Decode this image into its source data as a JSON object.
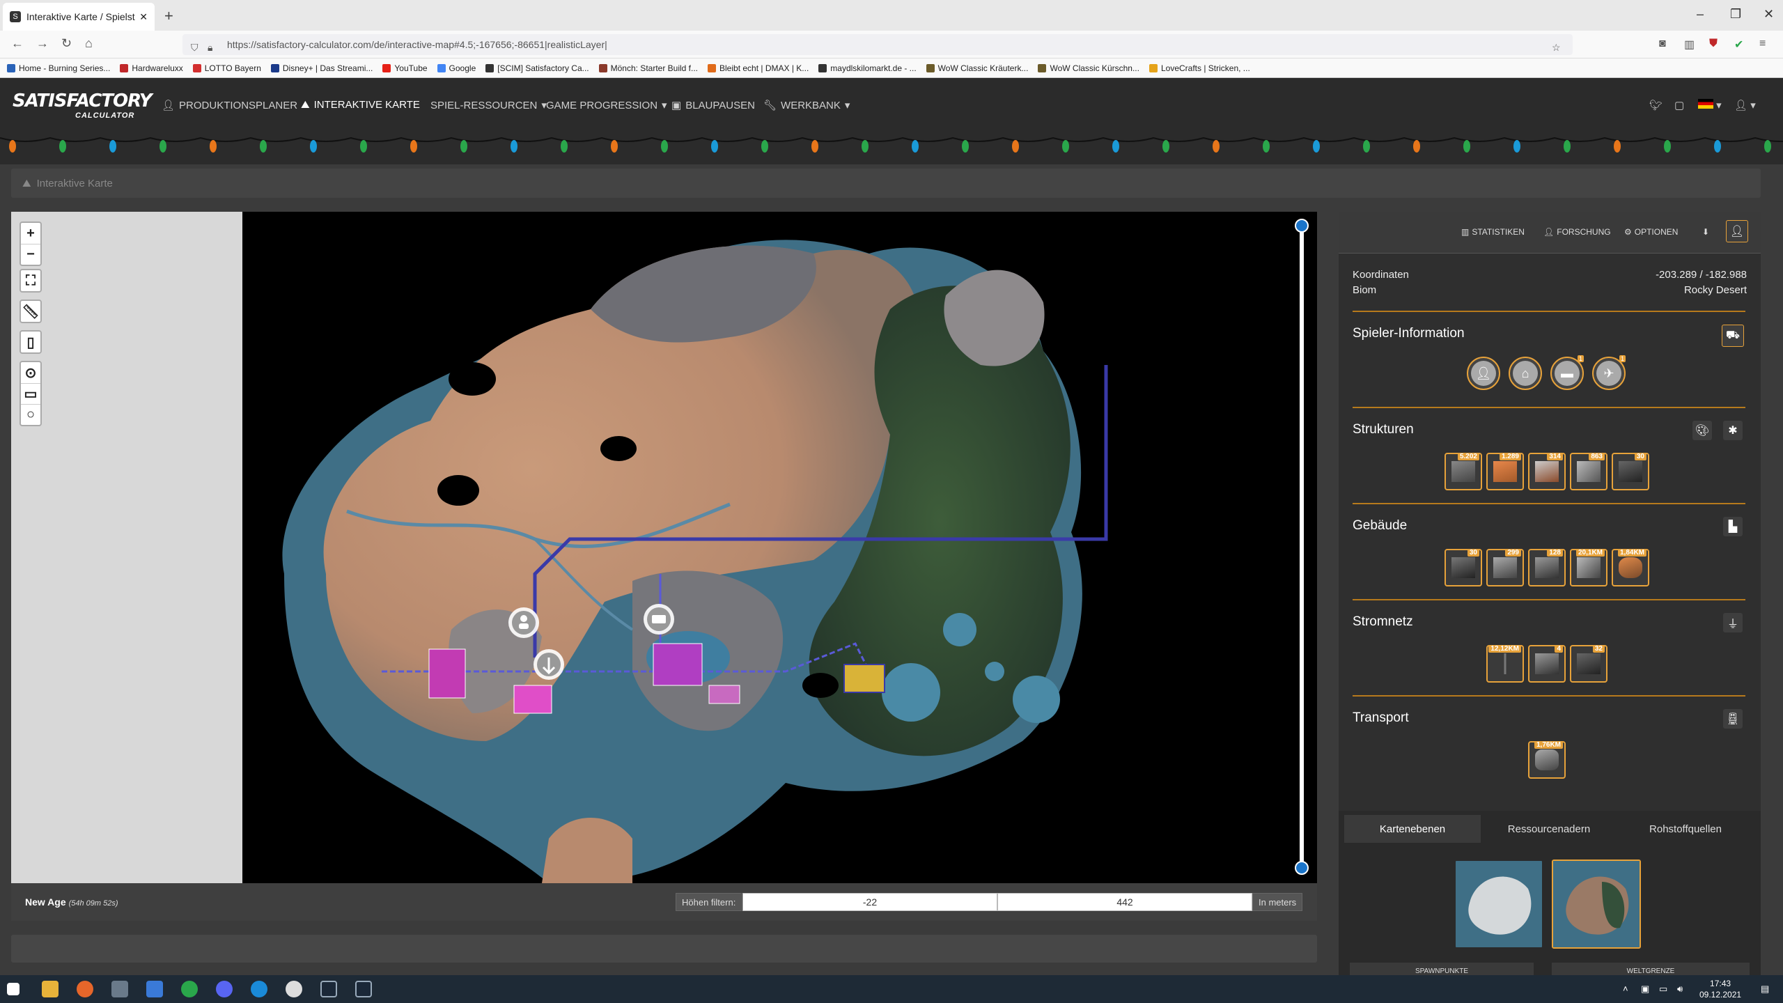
{
  "browser": {
    "tab_title": "Interaktive Karte / Spielstand Ed",
    "tab_favicon": "S",
    "url": "https://satisfactory-calculator.com/de/interactive-map#4.5;-167656;-86651|realisticLayer|",
    "bookmarks": [
      {
        "label": "Home - Burning Series...",
        "color": "#2a63b8"
      },
      {
        "label": "Hardwareluxx",
        "color": "#c0282a"
      },
      {
        "label": "LOTTO Bayern",
        "color": "#d32f2f"
      },
      {
        "label": "Disney+ | Das Streami...",
        "color": "#1b3a8a"
      },
      {
        "label": "YouTube",
        "color": "#e62117"
      },
      {
        "label": "Google",
        "color": "#4285f4"
      },
      {
        "label": "[SCIM] Satisfactory Ca...",
        "color": "#333333"
      },
      {
        "label": "Mönch: Starter Build f...",
        "color": "#8b3a2b"
      },
      {
        "label": "Bleibt echt | DMAX | K...",
        "color": "#e06b1a"
      },
      {
        "label": "maydlskilomarkt.de - ...",
        "color": "#333333"
      },
      {
        "label": "WoW Classic Kräuterk...",
        "color": "#6b5b2a"
      },
      {
        "label": "WoW Classic Kürschn...",
        "color": "#6b5b2a"
      },
      {
        "label": "LoveCrafts | Stricken, ...",
        "color": "#e5a31a"
      }
    ]
  },
  "site": {
    "logo_main": "SATISFACTORY",
    "logo_sub": "CALCULATOR",
    "nav": [
      {
        "label": "PRODUKTIONSPLANER",
        "icon": "user-icon"
      },
      {
        "label": "INTERAKTIVE KARTE",
        "icon": "map-icon"
      },
      {
        "label": "SPIEL-RESSOURCEN",
        "icon": ""
      },
      {
        "label": "GAME PROGRESSION",
        "icon": ""
      },
      {
        "label": "BLAUPAUSEN",
        "icon": "blueprint-icon"
      },
      {
        "label": "WERKBANK",
        "icon": "wrench-icon"
      }
    ],
    "dropdown_caret": "▾"
  },
  "breadcrumb": {
    "label": "Interaktive Karte"
  },
  "map": {
    "save_name": "New Age",
    "play_time": "(54h 09m 52s)",
    "height_filter_label": "Höhen filtern:",
    "height_min": "-22",
    "height_max": "442",
    "unit_label": "In meters",
    "zoom_in": "+",
    "zoom_out": "−"
  },
  "panel": {
    "toolbar": {
      "stats": "STATISTIKEN",
      "research": "FORSCHUNG",
      "options": "OPTIONEN"
    },
    "coord_label": "Koordinaten",
    "coord_value": "-203.289 / -182.988",
    "biome_label": "Biom",
    "biome_value": "Rocky Desert",
    "sections": {
      "player": "Spieler-Information",
      "structures": "Strukturen",
      "buildings": "Gebäude",
      "power": "Stromnetz",
      "transport": "Transport"
    },
    "player_badges": [
      "1",
      "1"
    ],
    "structures_badges": [
      "5.202",
      "1.289",
      "314",
      "863",
      "30"
    ],
    "buildings_badges": [
      "30",
      "299",
      "128",
      "20,1KM",
      "1,84KM"
    ],
    "power_badges": [
      "12,12KM",
      "4",
      "32"
    ],
    "transport_badges": [
      "1,76KM"
    ],
    "tabs": [
      "Kartenebenen",
      "Ressourcenadern",
      "Rohstoffquellen"
    ],
    "bottom_buttons": [
      "SPAWNPUNKTE",
      "WELTGRENZE"
    ]
  },
  "taskbar": {
    "time": "17:43",
    "date": "09.12.2021"
  },
  "colors": {
    "accent": "#e7a23a",
    "header_bg": "#2b2b2b",
    "panel_bg": "#2f2f2f",
    "knob": "#1a74c9"
  }
}
